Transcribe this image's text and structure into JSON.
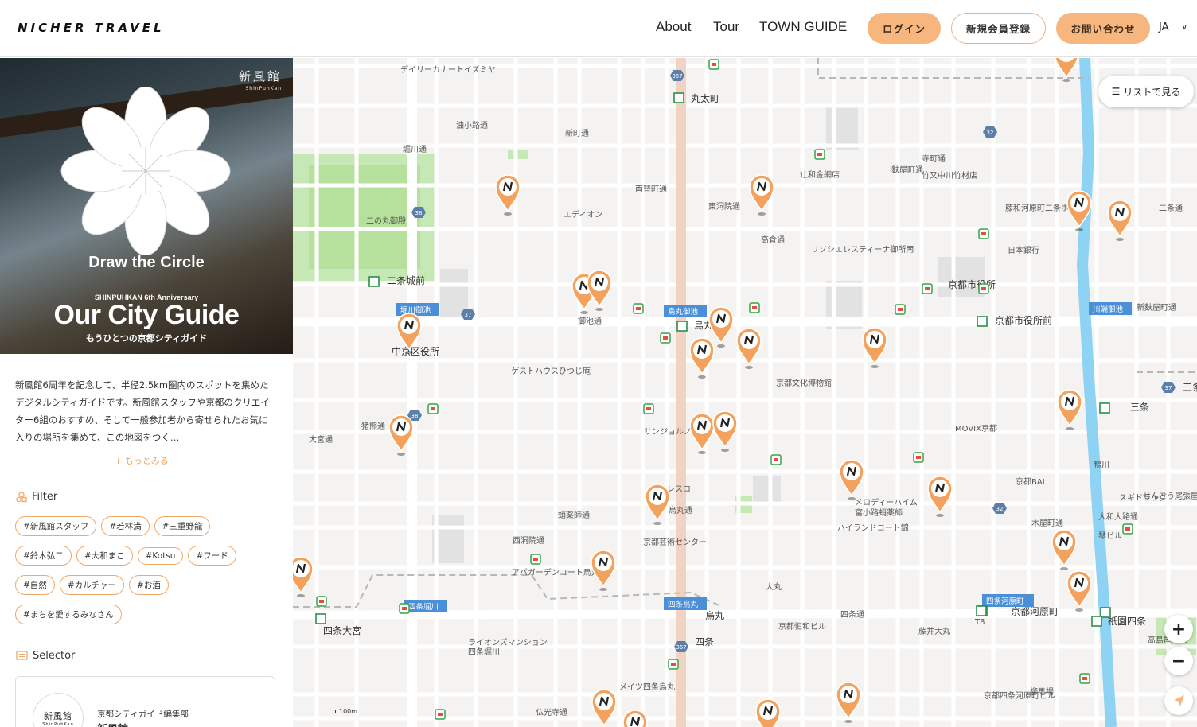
{
  "header": {
    "logo": "NICHER TRAVEL",
    "nav": [
      "About",
      "Tour",
      "TOWN GUIDE"
    ],
    "login": "ログイン",
    "signup": "新規会員登録",
    "contact": "お問い合わせ",
    "lang": "JA"
  },
  "hero": {
    "brand": "新風館",
    "brand_sub": "ShinPuhKan",
    "tagline": "Draw the Circle",
    "anniversary": "SHINPUHKAN 6th Anniversary",
    "title": "Our City Guide",
    "subtitle": "もうひとつの京都シティガイド"
  },
  "description": "新風館6周年を記念して、半径2.5km圏内のスポットを集めたデジタルシティガイドです。新風館スタッフや京都のクリエイター6組のおすすめ、そして一般参加者から寄せられたお気に入りの場所を集めて、この地図をつく…",
  "more_label": "もっとみる",
  "filter": {
    "label": "Filter",
    "tags": [
      "#新風館スタッフ",
      "#若林満",
      "#三重野龍",
      "#鈴木弘二",
      "#大和まこ",
      "#Kotsu",
      "#フード",
      "#自然",
      "#カルチャー",
      "#お酒",
      "#まちを愛するみなさん"
    ]
  },
  "selector": {
    "label": "Selector",
    "avatar": "新風館",
    "avatar_sub": "ShinPuhKan",
    "org": "京都シティガイド編集部",
    "name": "新風館"
  },
  "map": {
    "list_button": "リストで見る",
    "scale": "100m",
    "colors": {
      "accent": "#f6b67d",
      "pin": "#f2a25c",
      "water": "#8fd3f4",
      "park": "#c6e8b4",
      "station_label": "#4a8fd8"
    },
    "labels": [
      {
        "t": "デイリーカナートイズミヤ",
        "k": "s"
      },
      {
        "t": "丸太町",
        "k": "b"
      },
      {
        "t": "油小路通",
        "k": "s"
      },
      {
        "t": "新町通",
        "k": "s"
      },
      {
        "t": "堀川通",
        "k": "s"
      },
      {
        "t": "辻和金網店",
        "k": "s"
      },
      {
        "t": "麩屋町通",
        "k": "s"
      },
      {
        "t": "寺町通",
        "k": "s"
      },
      {
        "t": "竹又中川竹材店",
        "k": "s"
      },
      {
        "t": "両替町通",
        "k": "s"
      },
      {
        "t": "東洞院通",
        "k": "s"
      },
      {
        "t": "藤和河原町二条ホ",
        "k": "s"
      },
      {
        "t": "二条通",
        "k": "s"
      },
      {
        "t": "エディオン",
        "k": "s"
      },
      {
        "t": "二の丸御殿",
        "k": "s"
      },
      {
        "t": "高倉通",
        "k": "s"
      },
      {
        "t": "リソシエレスティーナ御所南",
        "k": "s"
      },
      {
        "t": "日本銀行",
        "k": "s"
      },
      {
        "t": "二条城前",
        "k": "b"
      },
      {
        "t": "京都市役所",
        "k": "b"
      },
      {
        "t": "新麩屋町通",
        "k": "s"
      },
      {
        "t": "御池通",
        "k": "s"
      },
      {
        "t": "烏丸",
        "k": "b"
      },
      {
        "t": "京都市役所前",
        "k": "b"
      },
      {
        "t": "中京区役所",
        "k": "b"
      },
      {
        "t": "ゲストハウスひつじ庵",
        "k": "s"
      },
      {
        "t": "京都文化博物館",
        "k": "s"
      },
      {
        "t": "三条京",
        "k": "b"
      },
      {
        "t": "猪熊通",
        "k": "s"
      },
      {
        "t": "大宮通",
        "k": "s"
      },
      {
        "t": "サンジョルノ",
        "k": "s"
      },
      {
        "t": "MOVIX京都",
        "k": "s"
      },
      {
        "t": "三条",
        "k": "b"
      },
      {
        "t": "鴨川",
        "k": "s"
      },
      {
        "t": "レスコ",
        "k": "s"
      },
      {
        "t": "烏丸通",
        "k": "s"
      },
      {
        "t": "スギドラッグ",
        "k": "s"
      },
      {
        "t": "京都BAL",
        "k": "s"
      },
      {
        "t": "蛸薬師通",
        "k": "s"
      },
      {
        "t": "メロディーハイム",
        "k": "s"
      },
      {
        "t": "富小路蛸薬師",
        "k": "s"
      },
      {
        "t": "せんこう尾張屋",
        "k": "s"
      },
      {
        "t": "ハイランドコート錦",
        "k": "s"
      },
      {
        "t": "木屋町通",
        "k": "s"
      },
      {
        "t": "大和大路通",
        "k": "s"
      },
      {
        "t": "西洞院通",
        "k": "s"
      },
      {
        "t": "京都芸術センター",
        "k": "s"
      },
      {
        "t": "琴ビル",
        "k": "s"
      },
      {
        "t": "アパガーデンコート烏丸",
        "k": "s"
      },
      {
        "t": "大丸",
        "k": "s"
      },
      {
        "t": "四条通",
        "k": "s"
      },
      {
        "t": "四条大宮",
        "k": "b"
      },
      {
        "t": "烏丸",
        "k": "b"
      },
      {
        "t": "京都河原町",
        "k": "b"
      },
      {
        "t": "祇園四条",
        "k": "b"
      },
      {
        "t": "京都恒和ビル",
        "k": "s"
      },
      {
        "t": "藤井大丸",
        "k": "s"
      },
      {
        "t": "ライオンズマンション",
        "k": "s"
      },
      {
        "t": "四条堀川",
        "k": "s"
      },
      {
        "t": "四条",
        "k": "b"
      },
      {
        "t": "高島屋S.C.",
        "k": "s"
      },
      {
        "t": "メイツ四条烏丸",
        "k": "s"
      },
      {
        "t": "柳馬場",
        "k": "s"
      },
      {
        "t": "京都四条河原町ビル",
        "k": "s"
      },
      {
        "t": "仏光寺通",
        "k": "s"
      },
      {
        "t": "T8",
        "k": "s"
      }
    ],
    "station_tags": [
      "烏丸御池",
      "堀川御池",
      "川端御池",
      "四条堀川",
      "四条烏丸",
      "四条河原町"
    ],
    "route_numbers": [
      "367",
      "38",
      "37",
      "32",
      "37",
      "38",
      "32",
      "367"
    ],
    "pin_count": 30
  }
}
